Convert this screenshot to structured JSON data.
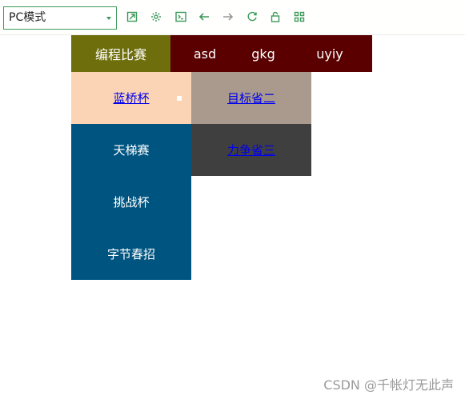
{
  "toolbar": {
    "mode_value": "PC模式",
    "icons": [
      "popout-icon",
      "gear-icon",
      "terminal-icon",
      "back-arrow-icon",
      "forward-arrow-icon",
      "refresh-icon",
      "lock-icon",
      "grid-icon"
    ],
    "accent": "#3c9a5a"
  },
  "nav": {
    "items": [
      "编程比赛",
      "asd",
      "gkg",
      "uyiy"
    ],
    "colors": {
      "first": "#6e6e0c",
      "rest": "#5a0000"
    }
  },
  "dropdown": {
    "col1": [
      "蓝桥杯",
      "天梯赛",
      "挑战杯",
      "字节春招"
    ],
    "col2": [
      "目标省二",
      "力争省三"
    ],
    "colors": {
      "light": "#fad4b5",
      "taupe": "#a99a8d",
      "gray": "#3f3f3f",
      "blue": "#005580"
    }
  },
  "watermark": "CSDN @千帐灯无此声"
}
